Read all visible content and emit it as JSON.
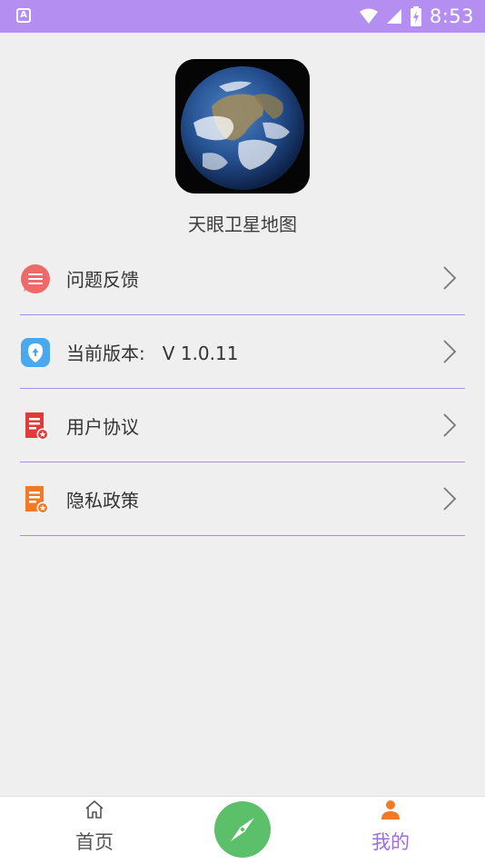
{
  "status_bar": {
    "time": "8:53",
    "left_icon": "A"
  },
  "app": {
    "name": "天眼卫星地图",
    "logo_icon": "earth-globe-icon"
  },
  "menu": [
    {
      "label": "问题反馈",
      "icon": "feedback-icon"
    },
    {
      "label": "当前版本:   V 1.0.11",
      "icon": "version-icon"
    },
    {
      "label": "用户协议",
      "icon": "user-agreement-icon"
    },
    {
      "label": "隐私政策",
      "icon": "privacy-policy-icon"
    }
  ],
  "tabs": [
    {
      "label": "首页",
      "icon": "home-icon",
      "color": "#555555"
    },
    {
      "label": "",
      "icon": "compass-icon",
      "color": "#5cbf6a"
    },
    {
      "label": "我的",
      "icon": "person-icon",
      "color": "#9b6ee0"
    }
  ],
  "colors": {
    "status_bar": "#b48ef0",
    "divider": "#a78ce8",
    "accent_orange": "#f07a28",
    "active_tab": "#9b6ee0"
  }
}
